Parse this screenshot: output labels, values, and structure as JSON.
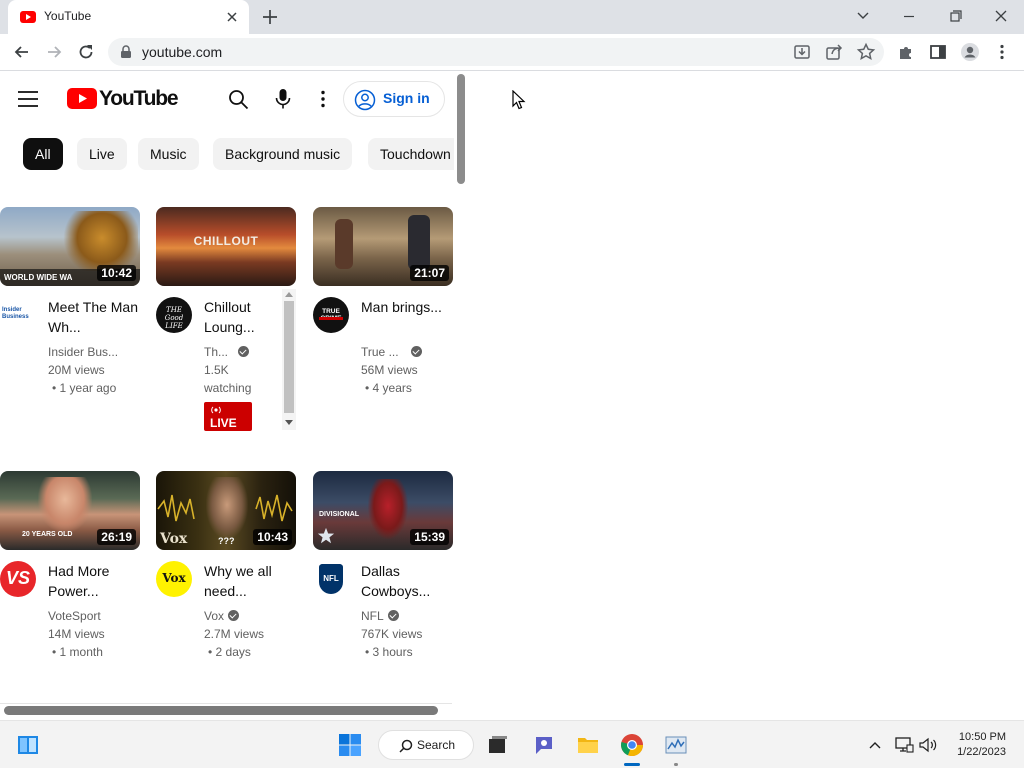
{
  "browser": {
    "tab_title": "YouTube",
    "url": "youtube.com"
  },
  "youtube": {
    "logo_text": "YouTube",
    "sign_in": "Sign in",
    "chips": [
      "All",
      "Live",
      "Music",
      "Background music",
      "Touchdown"
    ],
    "videos": [
      {
        "title": "Meet The Man Wh...",
        "channel": "Insider Bus...",
        "views": "20M views",
        "age": "1 year ago",
        "duration": "10:42",
        "thumb_text": "WORLD WIDE WA",
        "avatar_text": "Insider Business"
      },
      {
        "title": "Chillout Loung...",
        "channel": "Th...",
        "views": "1.5K",
        "age": "watching",
        "live_label": "LIVE",
        "thumb_text": "CHILLOUT",
        "avatar_text": "THE Good LIFE"
      },
      {
        "title": "Man brings...",
        "channel": "True ...",
        "views": "56M views",
        "age": "4 years",
        "duration": "21:07",
        "avatar_text": "TRUE CRIME"
      },
      {
        "title": "Had More Power...",
        "channel": "VoteSport",
        "views": "14M views",
        "age": "1 month",
        "duration": "26:19",
        "thumb_text": "20 YEARS OLD",
        "avatar_text": "VS"
      },
      {
        "title": "Why we all need...",
        "channel": "Vox",
        "views": "2.7M views",
        "age": "2 days",
        "duration": "10:43",
        "thumb_text": "Vox",
        "thumb_text2": "???",
        "avatar_text": "Vox"
      },
      {
        "title": "Dallas Cowboys...",
        "channel": "NFL",
        "views": "767K views",
        "age": "3 hours",
        "duration": "15:39",
        "thumb_text": "DIVISIONAL",
        "avatar_text": "NFL"
      }
    ]
  },
  "taskbar": {
    "search_label": "Search",
    "time": "10:50 PM",
    "date": "1/22/2023"
  },
  "colors": {
    "youtube_red": "#ff0000",
    "chip_active": "#0f0f0f",
    "sign_in_blue": "#065fd4",
    "live_red": "#cc0000"
  }
}
